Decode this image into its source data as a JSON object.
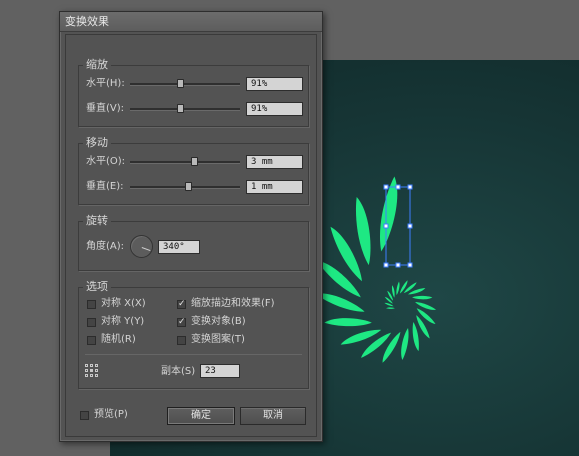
{
  "dialog": {
    "title": "变换效果"
  },
  "scale": {
    "legend": "缩放",
    "horizontal": {
      "label": "水平(H):",
      "value": "91%",
      "slider_percent": 91
    },
    "vertical": {
      "label": "垂直(V):",
      "value": "91%",
      "slider_percent": 91
    }
  },
  "move": {
    "legend": "移动",
    "horizontal": {
      "label": "水平(O):",
      "value": "3 mm"
    },
    "vertical": {
      "label": "垂直(E):",
      "value": "1 mm"
    }
  },
  "rotate": {
    "legend": "旋转",
    "angle_label": "角度(A):",
    "angle_value": "340°"
  },
  "options": {
    "legend": "选项",
    "reflect_x": {
      "label": "对称 X(X)",
      "checked": false
    },
    "reflect_y": {
      "label": "对称 Y(Y)",
      "checked": false
    },
    "random": {
      "label": "随机(R)",
      "checked": false
    },
    "scale_strokes": {
      "label": "缩放描边和效果(F)",
      "checked": true
    },
    "transform_objects": {
      "label": "变换对象(B)",
      "checked": true
    },
    "transform_patterns": {
      "label": "变换图案(T)",
      "checked": false
    },
    "copies_label": "副本(S)",
    "copies_value": "23"
  },
  "footer": {
    "preview": {
      "label": "预览(P)",
      "checked": false
    },
    "ok_label": "确定",
    "cancel_label": "取消"
  },
  "colors": {
    "petal": "#1ee883",
    "selection": "#3d7eff",
    "canvas": "#163535",
    "dialog": "#535353"
  },
  "icons": {
    "reference_point": "reference-point-icon",
    "rotate_dial": "angle-dial-icon"
  }
}
